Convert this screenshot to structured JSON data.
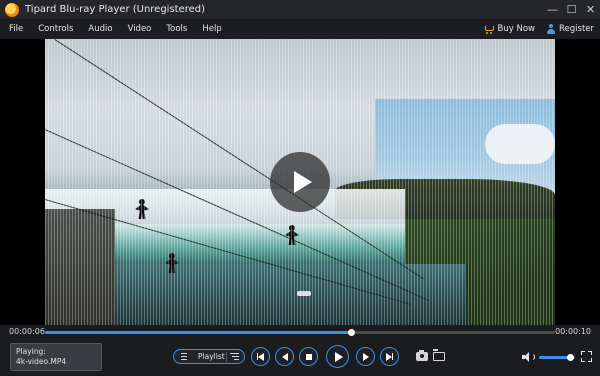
{
  "window": {
    "title": "Tipard Blu-ray Player (Unregistered)",
    "controls": {
      "minimize": "—",
      "maximize": "☐",
      "close": "✕"
    }
  },
  "menu": {
    "items": [
      "File",
      "Controls",
      "Audio",
      "Video",
      "Tools",
      "Help"
    ],
    "buy_now": "Buy Now",
    "register": "Register"
  },
  "player": {
    "time_elapsed": "00:00:06",
    "time_total": "00:00:10",
    "progress_fraction": 0.6,
    "volume_fraction": 0.85,
    "state": "paused"
  },
  "now_playing": {
    "label": "Playing:",
    "file": "4k-video.MP4"
  },
  "controls": {
    "playlist_label": "Playlist"
  },
  "colors": {
    "accent": "#3f8fe8",
    "titlebar": "#25262a",
    "controlbar": "#1b1c20"
  }
}
